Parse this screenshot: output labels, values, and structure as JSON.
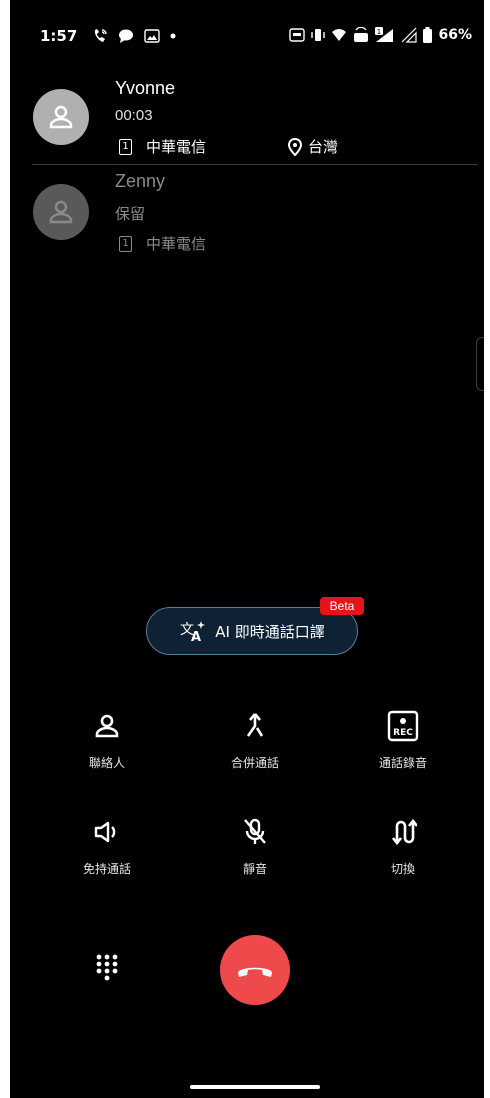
{
  "status_bar": {
    "time": "1:57",
    "battery": "66%",
    "signal_badge": "1"
  },
  "calls": [
    {
      "name": "Yvonne",
      "status": "00:03",
      "sim_slot": "1",
      "carrier": "中華電信",
      "location": "台灣",
      "avatar_color": "#b0b0b0"
    },
    {
      "name": "Zenny",
      "status": "保留",
      "sim_slot": "1",
      "carrier": "中華電信",
      "avatar_color": "#595959"
    }
  ],
  "ai_translate": {
    "label": "AI 即時通話口譯",
    "badge": "Beta",
    "icon": "translate-icon"
  },
  "actions": [
    {
      "label": "聯絡人",
      "icon": "contacts-icon"
    },
    {
      "label": "合併通話",
      "icon": "merge-call-icon"
    },
    {
      "label": "通話錄音",
      "icon": "record-icon",
      "icon_text": "REC"
    },
    {
      "label": "免持通話",
      "icon": "speaker-icon"
    },
    {
      "label": "靜音",
      "icon": "mute-mic-icon"
    },
    {
      "label": "切換",
      "icon": "swap-icon"
    }
  ],
  "end_call": {
    "icon": "end-call-icon",
    "color": "#ef4a4b"
  },
  "dialpad": {
    "icon": "dialpad-icon"
  }
}
